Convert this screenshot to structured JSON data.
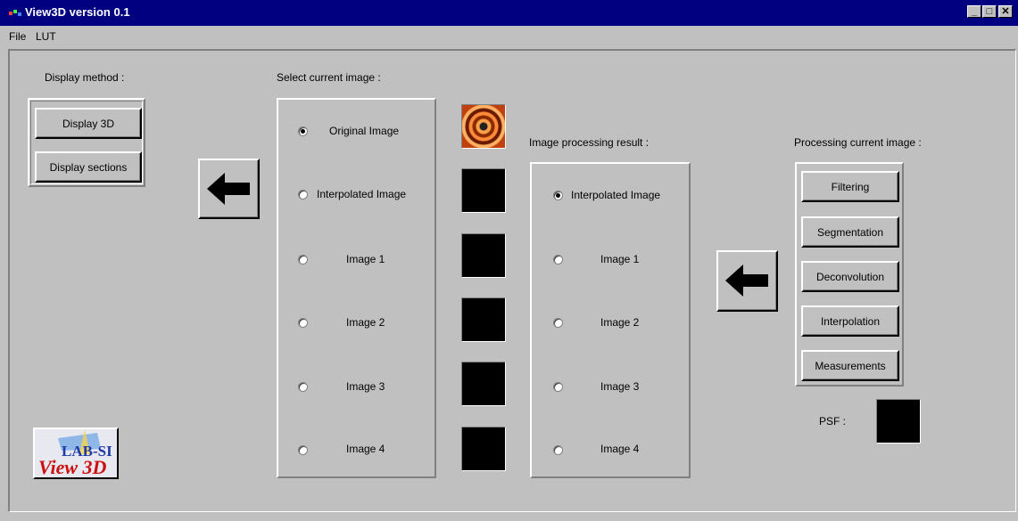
{
  "window": {
    "title": "View3D version 0.1",
    "min": "_",
    "max": "□",
    "close": "✕"
  },
  "menu": [
    "File",
    "LUT"
  ],
  "display": {
    "label": "Display method :",
    "buttons": [
      "Display 3D",
      "Display sections"
    ]
  },
  "current": {
    "label": "Select current image :",
    "options": [
      "Original Image",
      "Interpolated Image",
      "Image 1",
      "Image 2",
      "Image 3",
      "Image 4"
    ],
    "selected": 0
  },
  "result": {
    "label": "Image processing result :",
    "options": [
      "Interpolated Image",
      "Image 1",
      "Image 2",
      "Image 3",
      "Image 4"
    ],
    "selected": 0
  },
  "processing": {
    "label": "Processing current image :",
    "buttons": [
      "Filtering",
      "Segmentation",
      "Deconvolution",
      "Interpolation",
      "Measurements"
    ]
  },
  "psf": {
    "label": "PSF :"
  },
  "logo": {
    "text_top": "LAB-SI",
    "text_bottom": "View 3D"
  },
  "colors": {
    "titlebar": "#000080",
    "face": "#c0c0c0",
    "logo_red": "#cc1010",
    "logo_blue": "#1f3aa8"
  }
}
